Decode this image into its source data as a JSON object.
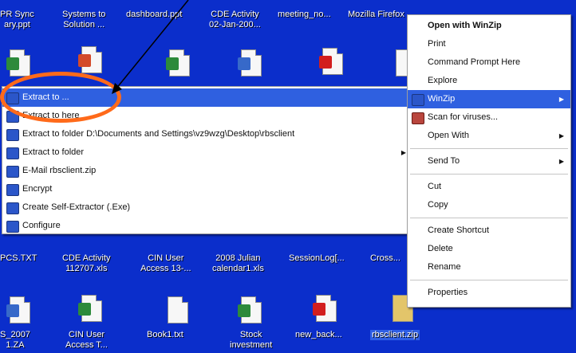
{
  "desktop": {
    "top_labels": [
      "PR Sync\nary.ppt",
      "Systems to\nSolution ...",
      "dashboard.ppt",
      "CDE Activity\n02-Jan-200...",
      "meeting_no...",
      "Mozilla Firefox"
    ],
    "mid_labels": [
      "PCS.TXT",
      "CDE Activity\n112707.xls",
      "CIN User\nAccess 13-...",
      "2008 Julian\ncalendar1.xls",
      "SessionLog[...",
      "Cross..."
    ],
    "bottom_labels": [
      "S_2007\n1.ZA",
      "CIN User\nAccess T...",
      "Book1.txt",
      "Stock\ninvestment",
      "new_back...",
      "rbsclient.zip"
    ]
  },
  "winzip_menu": {
    "items": [
      "Extract to ...",
      "Extract to here",
      "Extract to folder D:\\Documents and Settings\\vz9wzg\\Desktop\\rbsclient",
      "Extract to folder",
      "E-Mail rbsclient.zip",
      "Encrypt",
      "Create Self-Extractor (.Exe)",
      "Configure"
    ]
  },
  "context_menu": {
    "open_with_winzip": "Open with WinZip",
    "print": "Print",
    "command_prompt": "Command Prompt Here",
    "explore": "Explore",
    "winzip": "WinZip",
    "scan": "Scan for viruses...",
    "open_with": "Open With",
    "send_to": "Send To",
    "cut": "Cut",
    "copy": "Copy",
    "create_shortcut": "Create Shortcut",
    "delete": "Delete",
    "rename": "Rename",
    "properties": "Properties"
  },
  "colors": {
    "desktop": "#0b2ecb",
    "highlight": "#2f60e0",
    "annotation_ring": "#ff6a1a"
  }
}
